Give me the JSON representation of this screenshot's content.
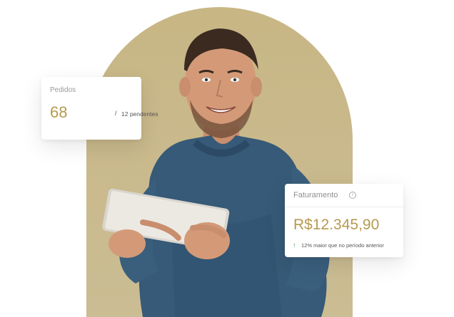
{
  "orders_card": {
    "label": "Pedidos",
    "count": "68",
    "separator": "/",
    "pending": "12 pendentes"
  },
  "revenue_card": {
    "label": "Faturamento",
    "info_icon": "info-icon",
    "amount": "R$12.345,90",
    "trend_icon": "arrow-up-icon",
    "trend_text": "12% maior que no período anterior"
  },
  "colors": {
    "accent": "#b59a4e",
    "arch": "#c8b684",
    "trend_positive": "#2e9d4a"
  }
}
